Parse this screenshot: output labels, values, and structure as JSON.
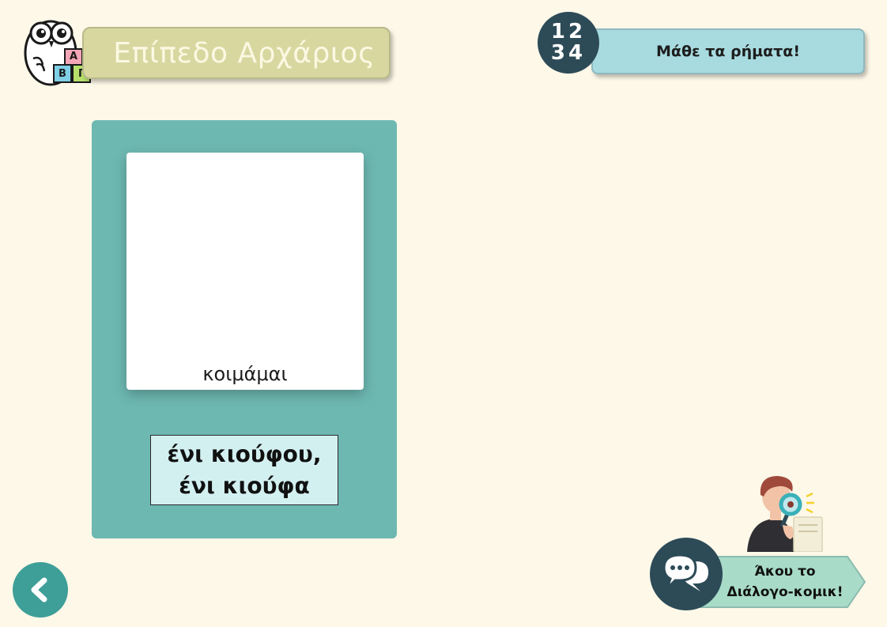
{
  "header": {
    "level_title": "Επίπεδο Αρχάριος",
    "blocks": [
      "Α",
      "Β",
      "Γ"
    ],
    "numbers_top": "12",
    "numbers_bottom": "34",
    "learn_title": "Μάθε τα ρήματα!"
  },
  "card": {
    "image_caption": "κοιμάμαι",
    "translation_line1": "ένι κιούφου,",
    "translation_line2": "ένι κιούφα"
  },
  "comic": {
    "line1": "Άκου το",
    "line2": "Διάλογο-κομικ!"
  },
  "icons": {
    "owl": "owl-with-abc-blocks-icon",
    "back": "chevron-left-icon",
    "chat": "chat-bubbles-icon",
    "detective": "detective-magnifier-icon"
  },
  "colors": {
    "background": "#fdf8e8",
    "level_banner": "#d8d7a0",
    "learn_banner": "#a8dbe0",
    "card": "#6eb8b2",
    "dark_circle": "#2d4a57",
    "back_button": "#3e9e98"
  }
}
